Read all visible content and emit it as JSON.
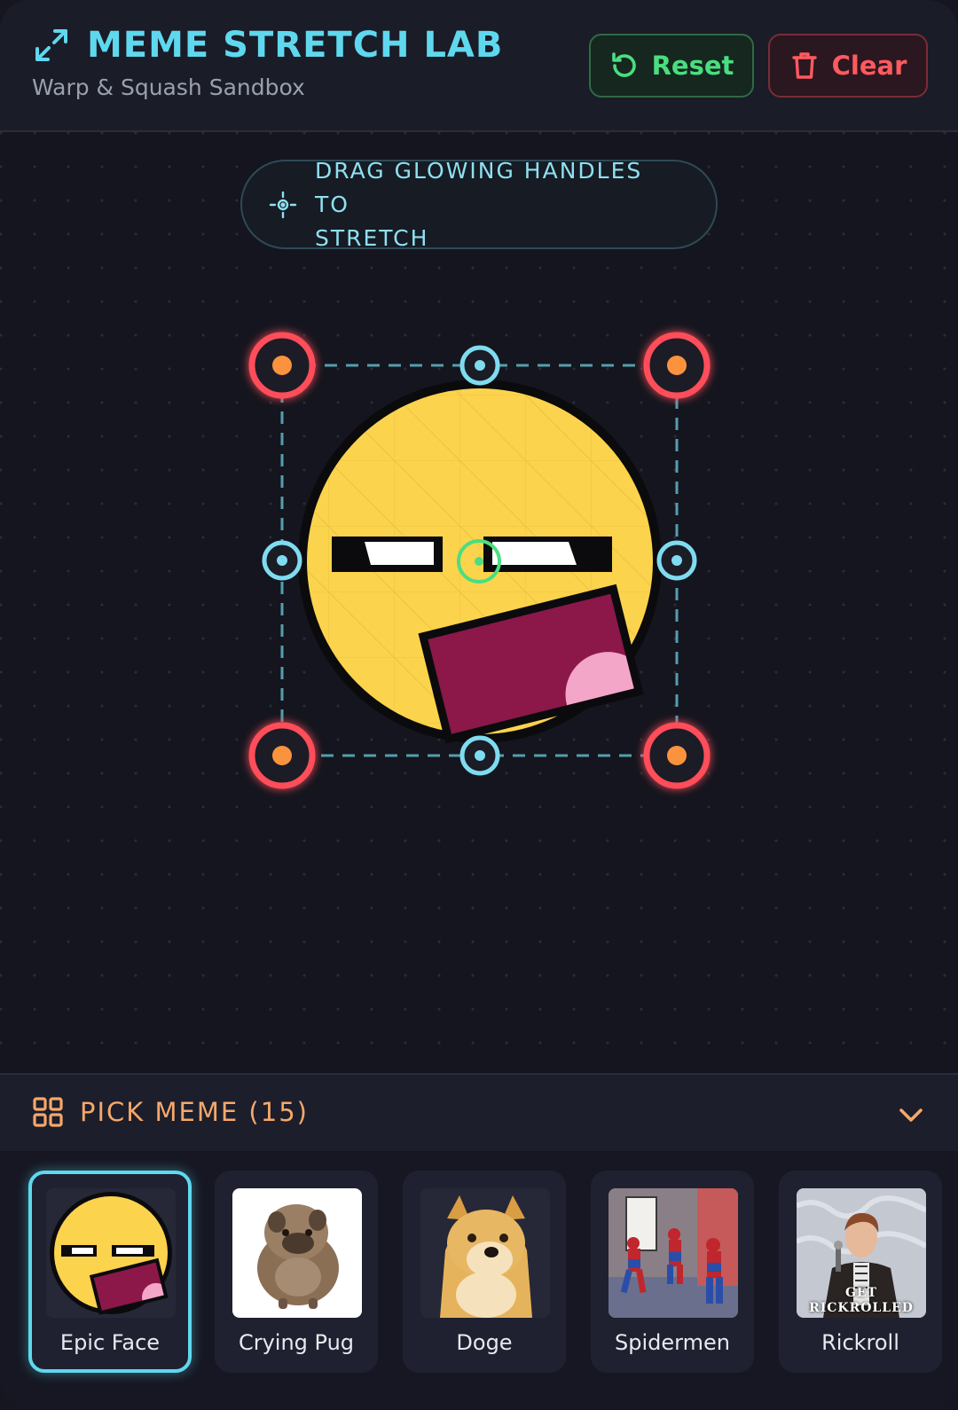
{
  "header": {
    "title": "MEME STRETCH LAB",
    "subtitle": "Warp & Squash Sandbox",
    "reset_label": "Reset",
    "clear_label": "Clear"
  },
  "canvas": {
    "hint_line1": "DRAG GLOWING HANDLES TO",
    "hint_line2": "STRETCH"
  },
  "picker": {
    "label": "PICK MEME (15)",
    "items": [
      {
        "label": "Epic Face",
        "selected": true
      },
      {
        "label": "Crying Pug",
        "selected": false
      },
      {
        "label": "Doge",
        "selected": false
      },
      {
        "label": "Spidermen",
        "selected": false
      },
      {
        "label": "Rickroll",
        "selected": false
      }
    ],
    "rickroll_caption_1": "GET",
    "rickroll_caption_2": "RICKROLLED"
  },
  "colors": {
    "accent_cyan": "#5fd8ee",
    "reset_green": "#4ade80",
    "clear_red": "#ff5a5f",
    "corner_handle": "#ff4d5a",
    "picker_orange": "#f6a86a"
  },
  "icons": [
    "expand-icon",
    "refresh-icon",
    "trash-icon",
    "crosshair-icon",
    "grid-icon",
    "chevron-down-icon"
  ]
}
